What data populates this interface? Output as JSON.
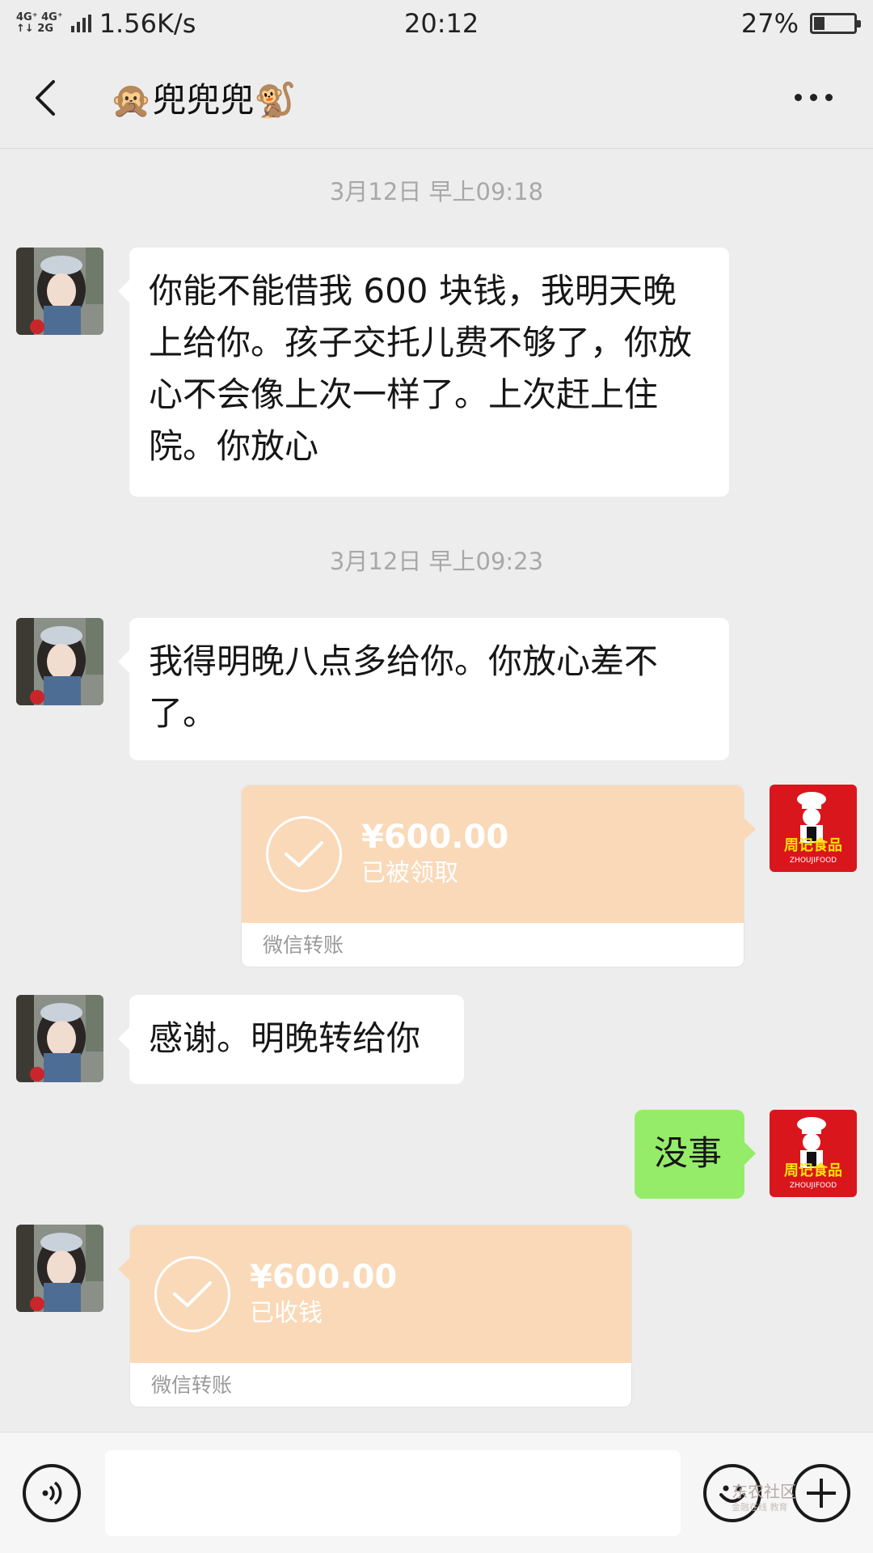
{
  "status_bar": {
    "network_top": "4G⁺ 4G⁺",
    "network_bottom": "↑↓ 2G",
    "speed": "1.56K/s",
    "time": "20:12",
    "battery_percent": "27%",
    "battery_level": 0.27
  },
  "nav": {
    "title": "🙊兜兜兜🐒"
  },
  "messages": {
    "ts1": "3月12日 早上09:18",
    "msg1": "你能不能借我 600 块钱，我明天晚上给你。孩子交托儿费不够了，你放心不会像上次一样了。上次赶上住院。你放心",
    "ts2": "3月12日 早上09:23",
    "msg2": "我得明晚八点多给你。你放心差不了。",
    "transfer1": {
      "amount": "¥600.00",
      "status": "已被领取",
      "label": "微信转账"
    },
    "msg3": "感谢。明晚转给你",
    "msg4": "没事",
    "transfer2": {
      "amount": "¥600.00",
      "status": "已收钱",
      "label": "微信转账"
    }
  },
  "own_avatar": {
    "brand_text": "周记食品",
    "brand_sub": "ZHOUJIFOOD"
  },
  "watermark": {
    "line1": "东农社区",
    "line2": "金融在线 教育"
  },
  "colors": {
    "background": "#ededed",
    "bubble_white": "#ffffff",
    "bubble_green": "#95ec69",
    "transfer_orange": "#f9d9b8",
    "timestamp_grey": "#a8a8a8"
  },
  "icons": [
    "back-icon",
    "more-icon",
    "check-icon",
    "voice-icon",
    "emoji-icon",
    "plus-icon"
  ]
}
